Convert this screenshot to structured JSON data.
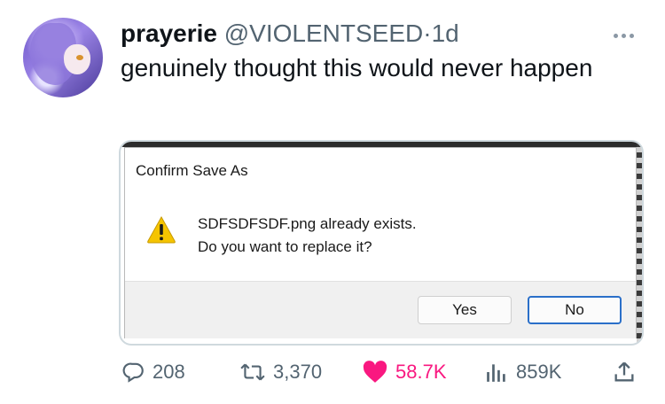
{
  "tweet": {
    "display_name": "prayerie",
    "handle": "@VIOLENTSEED",
    "separator": "·",
    "time": "1d",
    "text": "genuinely thought this would never happen"
  },
  "dialog": {
    "title": "Confirm Save As",
    "line1": "SDFSDFSDF.png already exists.",
    "line2": "Do you want to replace it?",
    "yes_label": "Yes",
    "no_label": "No"
  },
  "actions": {
    "replies": "208",
    "retweets": "3,370",
    "likes": "58.7K",
    "views": "859K"
  },
  "colors": {
    "like": "#f91880",
    "muted": "#536471",
    "focus": "#2a6fc9",
    "warning": "#f5c400"
  },
  "icons": [
    "more-icon",
    "warning-icon",
    "reply-icon",
    "retweet-icon",
    "like-icon",
    "views-icon",
    "share-icon"
  ]
}
